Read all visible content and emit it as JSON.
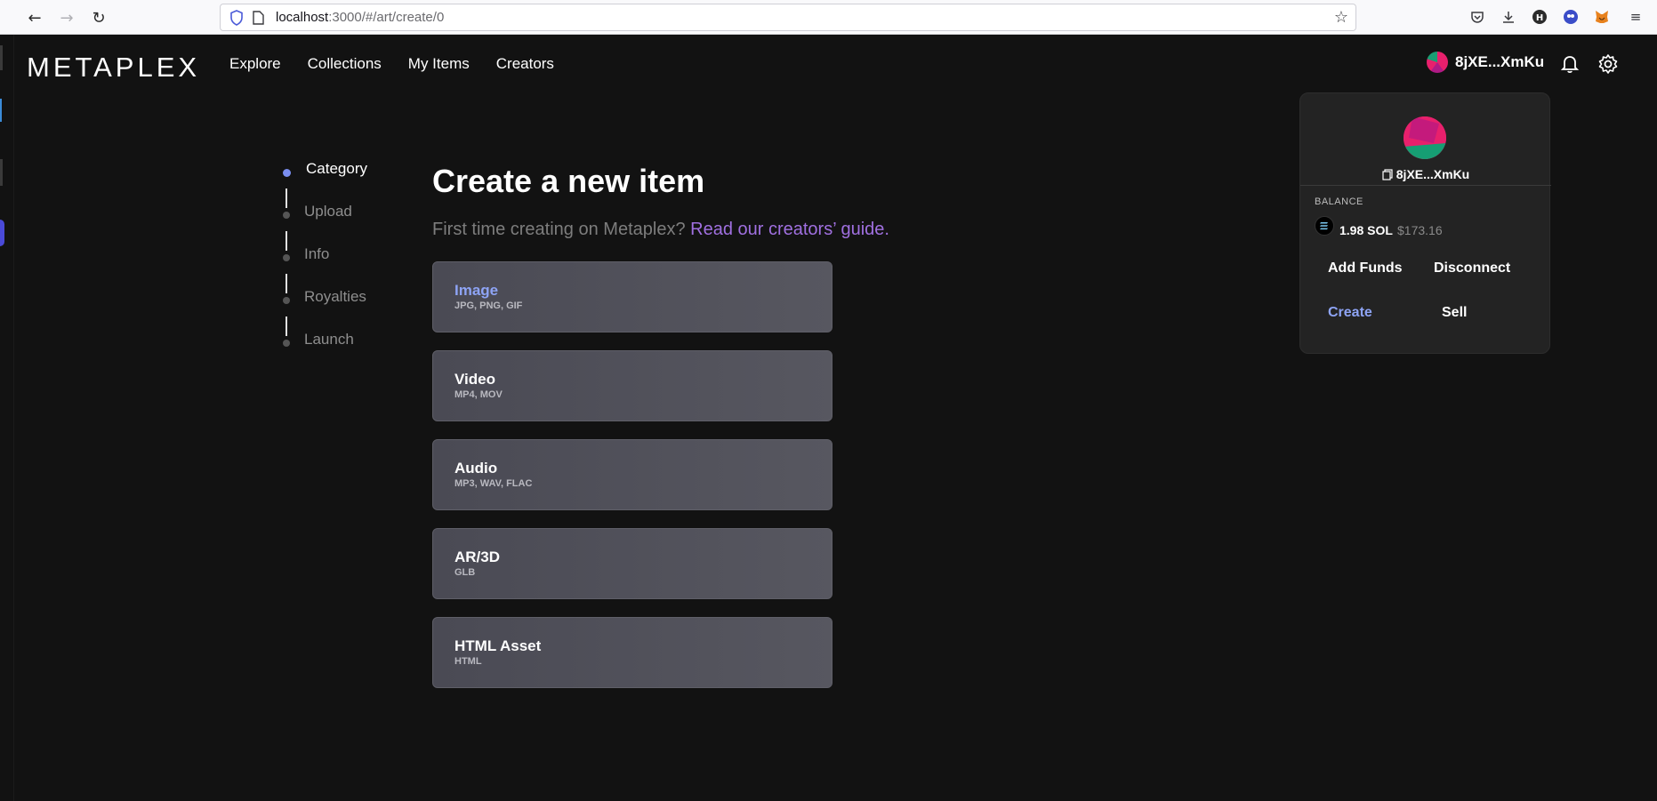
{
  "browser": {
    "url_host": "localhost",
    "url_path": ":3000/#/art/create/0"
  },
  "app": {
    "logo": "METAPLEX",
    "nav": [
      "Explore",
      "Collections",
      "My Items",
      "Creators"
    ],
    "wallet_short": "8jXE...XmKu"
  },
  "steps": [
    {
      "label": "Category",
      "active": true
    },
    {
      "label": "Upload",
      "active": false
    },
    {
      "label": "Info",
      "active": false
    },
    {
      "label": "Royalties",
      "active": false
    },
    {
      "label": "Launch",
      "active": false
    }
  ],
  "main": {
    "title": "Create a new item",
    "subtitle": "First time creating on Metaplex?",
    "guide_link": "Read our creators’ guide.",
    "categories": [
      {
        "title": "Image",
        "formats": "JPG, PNG, GIF",
        "active": true
      },
      {
        "title": "Video",
        "formats": "MP4, MOV",
        "active": false
      },
      {
        "title": "Audio",
        "formats": "MP3, WAV, FLAC",
        "active": false
      },
      {
        "title": "AR/3D",
        "formats": "GLB",
        "active": false
      },
      {
        "title": "HTML Asset",
        "formats": "HTML",
        "active": false
      }
    ]
  },
  "popover": {
    "address": "8jXE...XmKu",
    "balance_label": "BALANCE",
    "sol_amount": "1.98 SOL",
    "usd_amount": "$173.16",
    "add_funds": "Add Funds",
    "disconnect": "Disconnect",
    "create": "Create",
    "sell": "Sell"
  },
  "colors": {
    "background": "#121212",
    "accent": "#8ea4f5",
    "link": "#a070e0",
    "card": "#4f4f58"
  }
}
